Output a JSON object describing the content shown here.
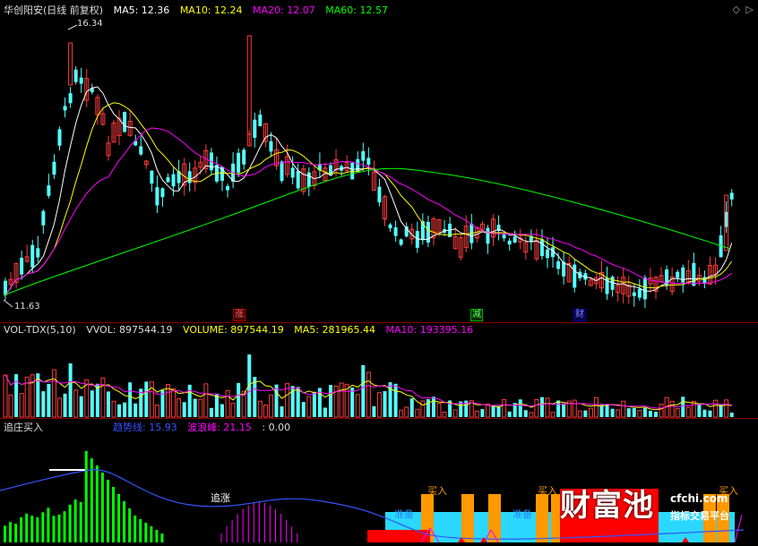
{
  "main_panel": {
    "title": "华创阳安(日线 前复权)",
    "ma5_label": "MA5: 12.36",
    "ma10_label": "MA10: 12.24",
    "ma20_label": "MA20: 12.07",
    "ma60_label": "MA60: 12.57",
    "high_label": "16.34",
    "low_label": "11.63",
    "marker_zhang": "涨",
    "marker_jian": "减",
    "marker_cai": "财",
    "colors": {
      "ma5": "#ffffff",
      "ma10": "#ffff00",
      "ma20": "#ff00ff",
      "ma60": "#00ff00",
      "up": "#ff3c3c",
      "down": "#54ffff"
    }
  },
  "volume_panel": {
    "title": "VOL-TDX(5,10)",
    "vvol_label": "VVOL: 897544.19",
    "volume_label": "VOLUME: 897544.19",
    "ma5_label": "MA5: 281965.44",
    "ma10_label": "MA10: 193395.16"
  },
  "indicator_panel": {
    "title": "追庄买入",
    "trend_label": "趋势线: 15.93",
    "wave_label": "波浪峰: 21.15",
    "extra_label": ": 0.00",
    "chase_label": "追涨",
    "buy_labels": [
      "买入",
      "买入",
      "买入"
    ],
    "prepare_labels": [
      "准备",
      "准备"
    ]
  },
  "watermark": {
    "brand": "财富池",
    "site": "cfchi.com",
    "slogan": "指标交易平台"
  }
}
